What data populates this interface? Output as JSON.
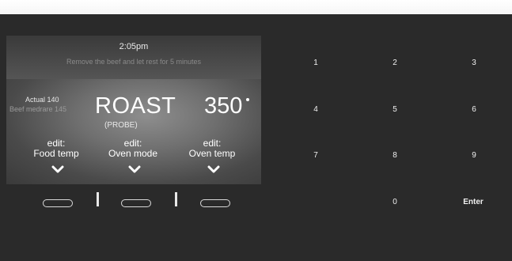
{
  "display": {
    "time": "2:05pm",
    "instruction": "Remove the beef and let rest for 5 minutes",
    "actual_label": "Actual  140",
    "target_label": "Beef medrare 145",
    "mode": "ROAST",
    "mode_sub": "(PROBE)",
    "oven_temp": "350",
    "edit_options": [
      {
        "line1": "edit:",
        "line2": "Food temp"
      },
      {
        "line1": "edit:",
        "line2": "Oven mode"
      },
      {
        "line1": "edit:",
        "line2": "Oven temp"
      }
    ]
  },
  "keypad": {
    "keys": [
      "1",
      "2",
      "3",
      "4",
      "5",
      "6",
      "7",
      "8",
      "9",
      "0",
      "Enter"
    ]
  },
  "icons": {
    "edit_arrow": "chevron-down-icon",
    "degree": "degree-icon"
  },
  "colors": {
    "background": "#2a2a2a",
    "display_glow": "#8e8e8e",
    "text": "#ffffff"
  }
}
